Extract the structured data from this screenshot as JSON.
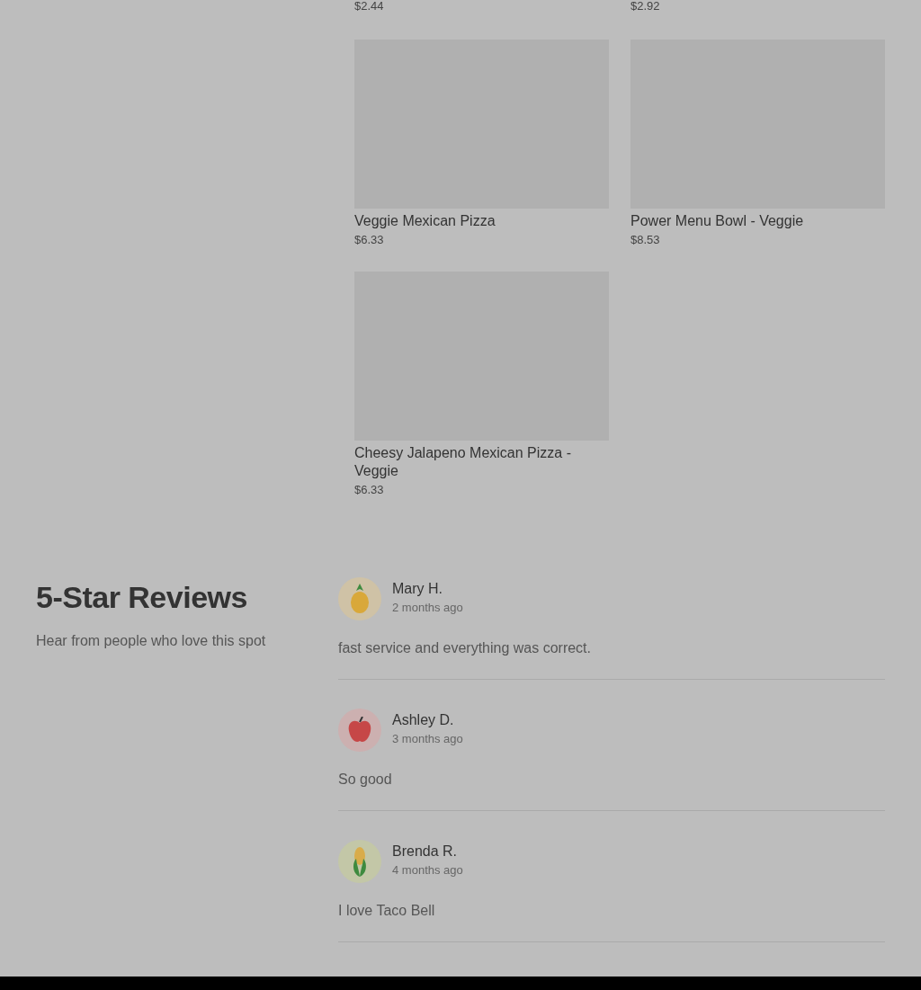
{
  "menu_items": [
    {
      "price": "$2.44"
    },
    {
      "price": "$2.92"
    },
    {
      "name": "Veggie Mexican Pizza",
      "price": "$6.33"
    },
    {
      "name": "Power Menu Bowl - Veggie",
      "price": "$8.53"
    },
    {
      "name": "Cheesy Jalapeno Mexican Pizza - Veggie",
      "price": "$6.33"
    }
  ],
  "reviews_section": {
    "title": "5-Star Reviews",
    "subtitle": "Hear from people who love this spot"
  },
  "reviews": [
    {
      "name": "Mary H.",
      "time": "2 months ago",
      "text": "fast service and everything was correct.",
      "kind": "pineapple"
    },
    {
      "name": "Ashley D.",
      "time": "3 months ago",
      "text": "So good",
      "kind": "apple"
    },
    {
      "name": "Brenda R.",
      "time": "4 months ago",
      "text": "I love Taco Bell",
      "kind": "corn"
    }
  ]
}
